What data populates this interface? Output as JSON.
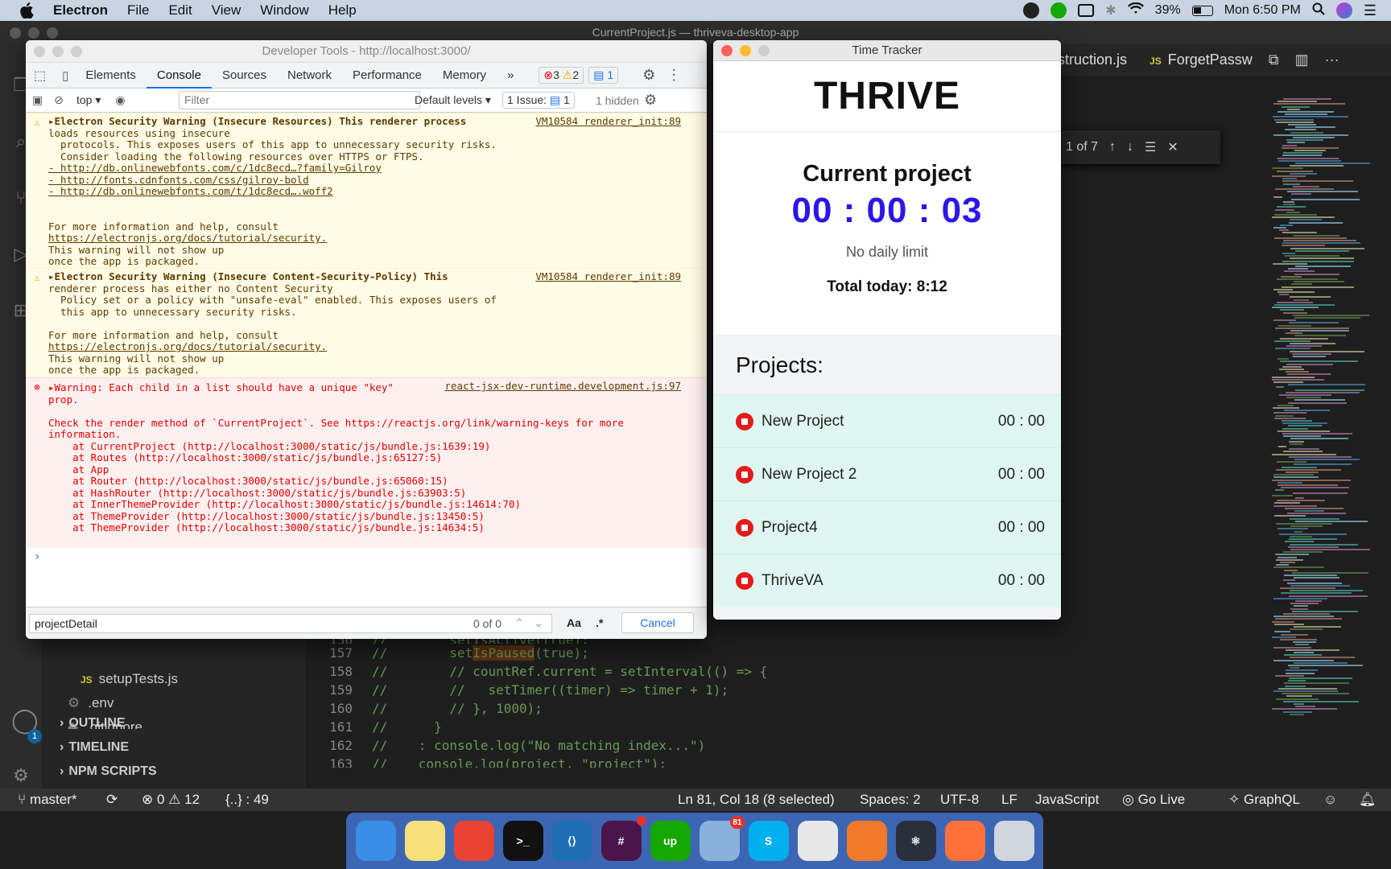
{
  "menubar": {
    "app": "Electron",
    "items": [
      "File",
      "Edit",
      "View",
      "Window",
      "Help"
    ],
    "battery": "39%",
    "clock": "Mon 6:50 PM"
  },
  "vscode": {
    "title": "CurrentProject.js — thriveva-desktop-app",
    "tabs": [
      "struction.js",
      "ForgetPassw"
    ],
    "tab_js_tag": "JS",
    "find_count": "1 of 7",
    "explorer": {
      "files": [
        {
          "tag": "JS",
          "name": "setupTests.js"
        },
        {
          "tag": "⚙",
          "name": ".env"
        },
        {
          "tag": "◆",
          "name": ".gitignore"
        }
      ],
      "sections": [
        "OUTLINE",
        "TIMELINE",
        "NPM SCRIPTS"
      ],
      "account_badge": "1"
    },
    "code_lines": [
      {
        "n": "156",
        "t": "//        setIsActive(true);"
      },
      {
        "n": "157",
        "t": "//        setIsPaused(true);"
      },
      {
        "n": "158",
        "t": "//        // countRef.current = setInterval(() => {"
      },
      {
        "n": "159",
        "t": "//        //   setTimer((timer) => timer + 1);"
      },
      {
        "n": "160",
        "t": "//        // }, 1000);"
      },
      {
        "n": "161",
        "t": "//      }"
      },
      {
        "n": "162",
        "t": "//    : console.log(\"No matching index...\")"
      },
      {
        "n": "163",
        "t": "//    console.log(project, \"project\");"
      }
    ],
    "status": {
      "branch": "master*",
      "errors": "0",
      "warnings": "12",
      "brackets": "{..} : 49",
      "position": "Ln 81, Col 18 (8 selected)",
      "spaces": "Spaces: 2",
      "encoding": "UTF-8",
      "eol": "LF",
      "language": "JavaScript",
      "golive": "Go Live",
      "graphql": "GraphQL"
    }
  },
  "devtools": {
    "title": "Developer Tools - http://localhost:3000/",
    "tabs": [
      "Elements",
      "Console",
      "Sources",
      "Network",
      "Performance",
      "Memory"
    ],
    "more": "»",
    "counts": {
      "errors": "3",
      "warnings": "2",
      "info": "1"
    },
    "toolbar": {
      "context": "top ▾",
      "filter_placeholder": "Filter",
      "levels": "Default levels ▾",
      "issues": "1 Issue:",
      "issues_count": "1",
      "hidden": "1 hidden"
    },
    "messages": [
      {
        "type": "warn",
        "source": "VM10584 renderer_init:89",
        "lines": [
          "▸Electron Security Warning (Insecure Resources) This renderer process",
          "loads resources using insecure",
          "  protocols. This exposes users of this app to unnecessary security risks.",
          "  Consider loading the following resources over HTTPS or FTPS.",
          "- http://db.onlinewebfonts.com/c/1dc8ecd…?family=Gilroy",
          "- http://fonts.cdnfonts.com/css/gilroy-bold",
          "- http://db.onlinewebfonts.com/t/1dc8ecd….woff2",
          "",
          "",
          "For more information and help, consult",
          "https://electronjs.org/docs/tutorial/security.",
          "This warning will not show up",
          "once the app is packaged."
        ]
      },
      {
        "type": "warn",
        "source": "VM10584 renderer_init:89",
        "lines": [
          "▸Electron Security Warning (Insecure Content-Security-Policy) This",
          "renderer process has either no Content Security",
          "  Policy set or a policy with \"unsafe-eval\" enabled. This exposes users of",
          "  this app to unnecessary security risks.",
          "",
          "For more information and help, consult",
          "https://electronjs.org/docs/tutorial/security.",
          "This warning will not show up",
          "once the app is packaged."
        ]
      },
      {
        "type": "err",
        "source": "react-jsx-dev-runtime.development.js:97",
        "lines": [
          "▸Warning: Each child in a list should have a unique \"key\"",
          "prop.",
          "",
          "Check the render method of `CurrentProject`. See https://reactjs.org/link/warning-keys for more",
          "information.",
          "    at CurrentProject (http://localhost:3000/static/js/bundle.js:1639:19)",
          "    at Routes (http://localhost:3000/static/js/bundle.js:65127:5)",
          "    at App",
          "    at Router (http://localhost:3000/static/js/bundle.js:65060:15)",
          "    at HashRouter (http://localhost:3000/static/js/bundle.js:63903:5)",
          "    at InnerThemeProvider (http://localhost:3000/static/js/bundle.js:14614:70)",
          "    at ThemeProvider (http://localhost:3000/static/js/bundle.js:13450:5)",
          "    at ThemeProvider (http://localhost:3000/static/js/bundle.js:14634:5)"
        ]
      }
    ],
    "prompt": "›",
    "find": {
      "value": "projectDetail",
      "count": "0 of 0",
      "case": "Aa",
      "regex": ".*",
      "cancel": "Cancel"
    }
  },
  "tracker": {
    "title": "Time Tracker",
    "logo": "THRIVE",
    "current_label": "Current project",
    "timer": "00 : 00 : 03",
    "limit": "No daily limit",
    "total": "Total today: 8:12",
    "projects_header": "Projects:",
    "projects": [
      {
        "name": "New Project",
        "time": "00 : 00"
      },
      {
        "name": "New Project 2",
        "time": "00 : 00"
      },
      {
        "name": "Project4",
        "time": "00 : 00"
      },
      {
        "name": "ThriveVA",
        "time": "00 : 00"
      }
    ]
  },
  "dock": {
    "apps": [
      {
        "icon": "finder-icon",
        "color": "#3a8ee6",
        "label": ""
      },
      {
        "icon": "notes-icon",
        "color": "#f7e07a",
        "label": ""
      },
      {
        "icon": "chrome-icon",
        "color": "#e94235",
        "label": ""
      },
      {
        "icon": "terminal-icon",
        "color": "#111111",
        "label": ">_"
      },
      {
        "icon": "vscode-icon",
        "color": "#1f6fb5",
        "label": "⟨⟩"
      },
      {
        "icon": "slack-icon",
        "color": "#4a154b",
        "label": "#"
      },
      {
        "icon": "upwork-icon",
        "color": "#14a800",
        "label": "up"
      },
      {
        "icon": "mail-icon",
        "color": "#8bb0d9",
        "label": ""
      },
      {
        "icon": "skype-icon",
        "color": "#00aff0",
        "label": "S"
      },
      {
        "icon": "textedit-icon",
        "color": "#e8e8e8",
        "label": ""
      },
      {
        "icon": "pen-icon",
        "color": "#f07a2a",
        "label": ""
      },
      {
        "icon": "electron-icon",
        "color": "#2b2e3b",
        "label": "⚛"
      },
      {
        "icon": "firefox-icon",
        "color": "#ff7139",
        "label": ""
      },
      {
        "icon": "trash-icon",
        "color": "#cfd6de",
        "label": ""
      }
    ],
    "mail_badge": "81"
  }
}
